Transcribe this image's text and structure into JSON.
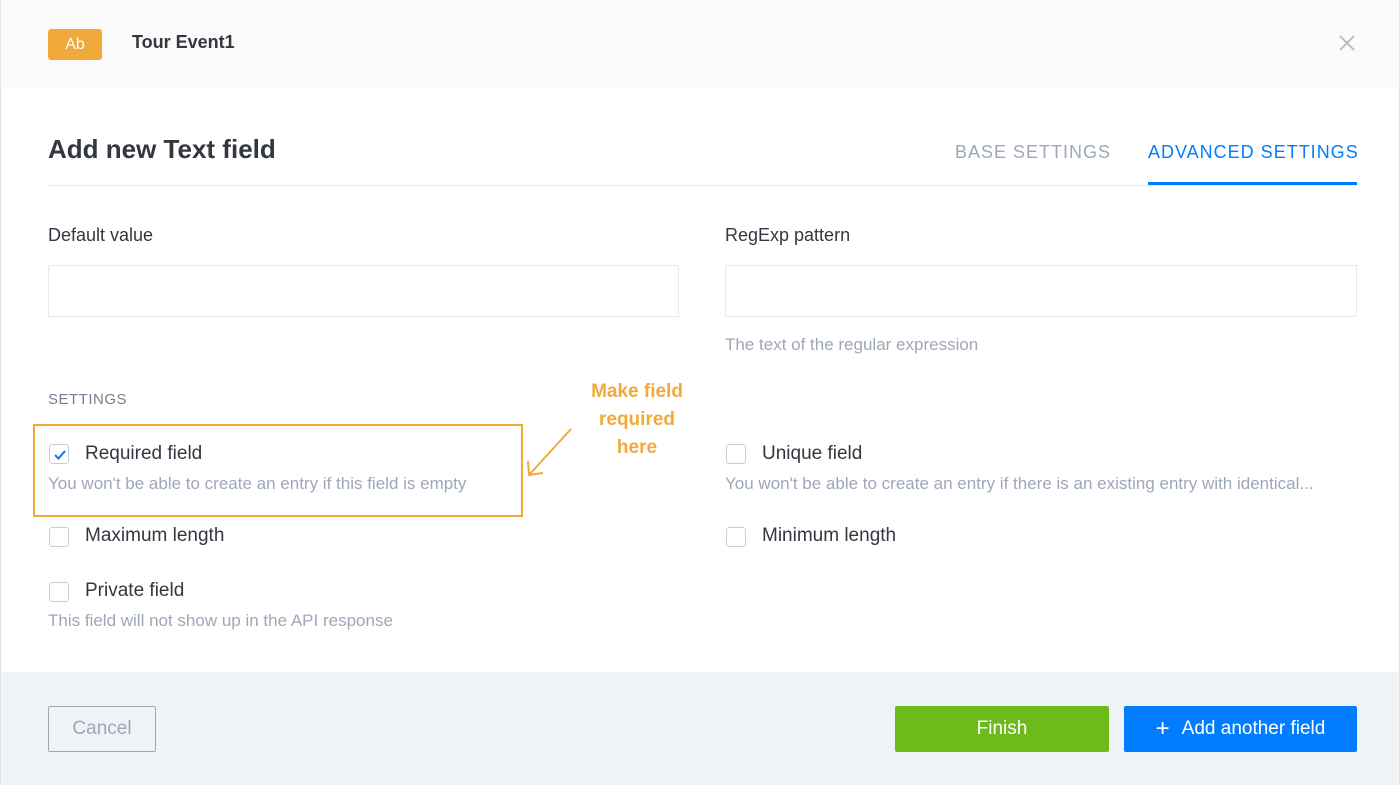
{
  "header": {
    "badge": "Ab",
    "content_type_name": "Tour Event1"
  },
  "modal": {
    "title": "Add new Text field",
    "tabs": [
      {
        "label": "BASE SETTINGS",
        "active": false
      },
      {
        "label": "ADVANCED SETTINGS",
        "active": true
      }
    ]
  },
  "fields": {
    "default_value": {
      "label": "Default value",
      "value": ""
    },
    "regexp": {
      "label": "RegExp pattern",
      "value": "",
      "helper": "The text of the regular expression"
    }
  },
  "settings": {
    "heading": "SETTINGS",
    "required": {
      "label": "Required field",
      "checked": true,
      "description": "You won't be able to create an entry if this field is empty"
    },
    "unique": {
      "label": "Unique field",
      "checked": false,
      "description": "You won't be able to create an entry if there is an existing entry with identical..."
    },
    "max_length": {
      "label": "Maximum length",
      "checked": false
    },
    "min_length": {
      "label": "Minimum length",
      "checked": false
    },
    "private": {
      "label": "Private field",
      "checked": false,
      "description": "This field will not show up in the API response"
    }
  },
  "annotation": {
    "line1": "Make field",
    "line2": "required",
    "line3": "here",
    "color": "#f2a93b"
  },
  "footer": {
    "cancel_label": "Cancel",
    "finish_label": "Finish",
    "add_label": "Add another field"
  },
  "colors": {
    "accent": "#007eff",
    "finish": "#6dbb1a",
    "badge": "#f2a93b"
  }
}
